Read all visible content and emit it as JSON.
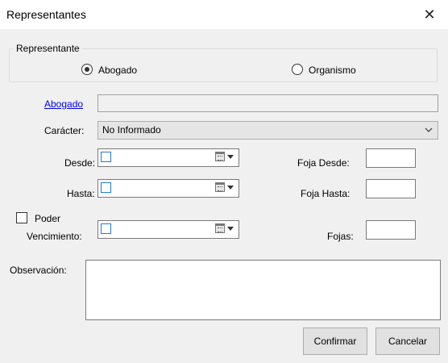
{
  "window": {
    "title": "Representantes",
    "close_symbol": "✕"
  },
  "representante_group": {
    "legend": "Representante",
    "options": [
      {
        "label": "Abogado",
        "checked": true
      },
      {
        "label": "Organismo",
        "checked": false
      }
    ]
  },
  "form": {
    "abogado_link": "Abogado",
    "abogado_value": "",
    "caracter_label": "Carácter:",
    "caracter_value": "No Informado",
    "desde_label": "Desde:",
    "hasta_label": "Hasta:",
    "poder_label": "Poder",
    "vencimiento_label": "Vencimiento:",
    "foja_desde_label": "Foja Desde:",
    "foja_hasta_label": "Foja Hasta:",
    "fojas_label": "Fojas:",
    "observacion_label": "Observación:"
  },
  "buttons": {
    "confirm": "Confirmar",
    "cancel": "Cancelar"
  },
  "icons": {
    "close": "close-icon",
    "dropdown": "chevron-down-icon",
    "calendar": "calendar-icon"
  },
  "colors": {
    "link": "#0000ee",
    "checkbox_accent": "#1e7ad6",
    "window_bg": "#f0f0f0"
  }
}
